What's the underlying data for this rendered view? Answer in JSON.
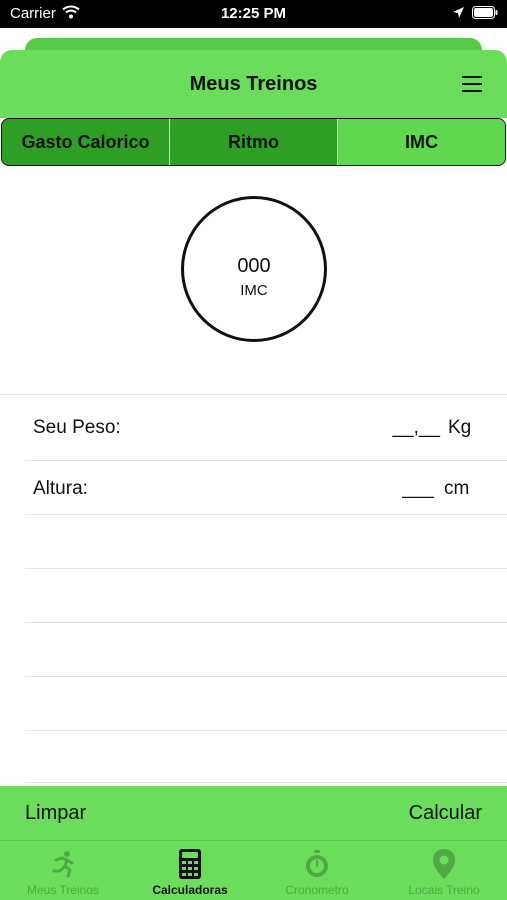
{
  "status_bar": {
    "carrier": "Carrier",
    "time": "12:25 PM"
  },
  "header": {
    "title": "Meus Treinos"
  },
  "segments": [
    {
      "label": "Gasto Calorico"
    },
    {
      "label": "Ritmo"
    },
    {
      "label": "IMC",
      "selected": true
    }
  ],
  "result": {
    "value": "000",
    "label": "IMC"
  },
  "form": {
    "weight": {
      "label": "Seu Peso:",
      "value": "__,__",
      "unit": "Kg"
    },
    "height": {
      "label": "Altura:",
      "value": "___",
      "unit": "cm"
    }
  },
  "actions": {
    "left": "Limpar",
    "right": "Calcular"
  },
  "tabs": [
    {
      "label": "Meus Treinos",
      "icon": "runner-icon"
    },
    {
      "label": "Calculadoras",
      "icon": "calculator-icon",
      "active": true
    },
    {
      "label": "Cronometro",
      "icon": "stopwatch-icon"
    },
    {
      "label": "Locais Treino",
      "icon": "location-pin-icon"
    }
  ],
  "colors": {
    "accent": "#6bdc5c",
    "segment_dark": "#2f9e24",
    "segment_selected": "#5fd84f",
    "tab_inactive": "#4fa944"
  }
}
